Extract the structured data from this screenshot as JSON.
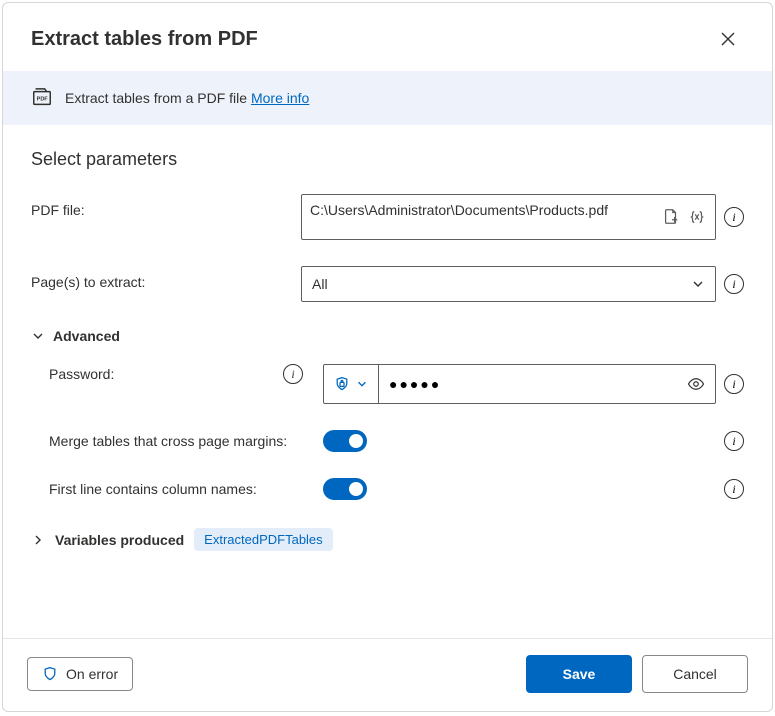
{
  "header": {
    "title": "Extract tables from PDF"
  },
  "banner": {
    "text": "Extract tables from a PDF file ",
    "link": "More info"
  },
  "section": {
    "title": "Select parameters"
  },
  "fields": {
    "pdf": {
      "label": "PDF file:",
      "value": "C:\\Users\\Administrator\\Documents\\Products.pdf"
    },
    "pages": {
      "label": "Page(s) to extract:",
      "value": "All"
    }
  },
  "advanced": {
    "label": "Advanced",
    "password": {
      "label": "Password:",
      "value_masked": "●●●●●"
    },
    "merge": {
      "label": "Merge tables that cross page margins:",
      "value": true
    },
    "first_line": {
      "label": "First line contains column names:",
      "value": true
    }
  },
  "variables": {
    "label": "Variables produced",
    "chip": "ExtractedPDFTables"
  },
  "footer": {
    "on_error": "On error",
    "save": "Save",
    "cancel": "Cancel"
  }
}
